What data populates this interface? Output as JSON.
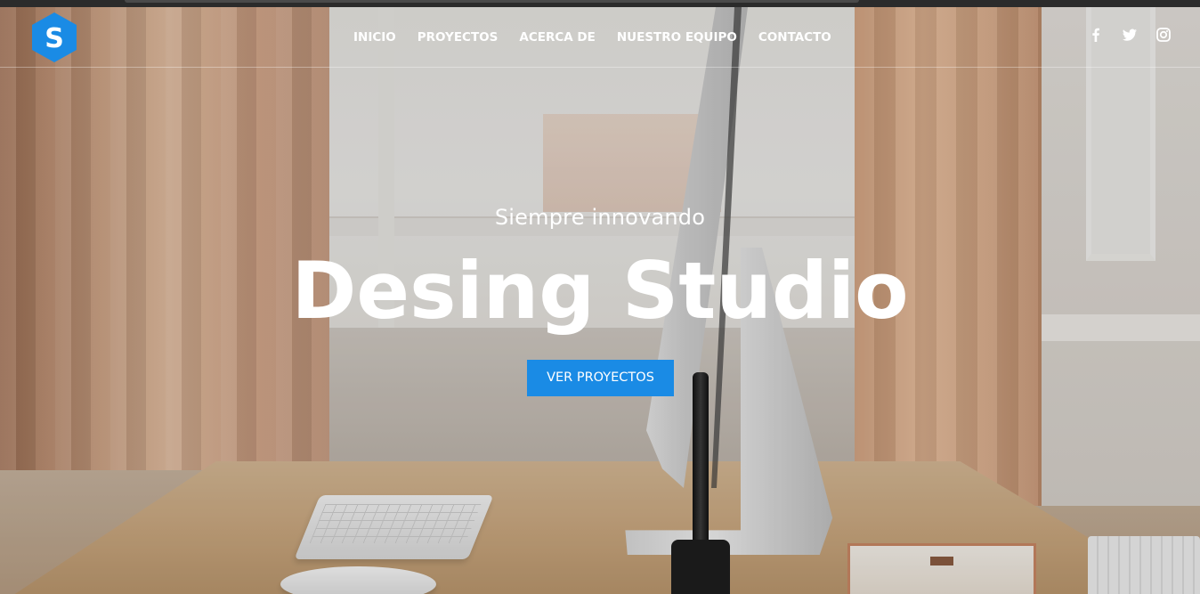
{
  "brand": {
    "logo_letter": "S",
    "logo_color": "#1a8be5"
  },
  "nav": {
    "items": [
      {
        "label": "INICIO"
      },
      {
        "label": "PROYECTOS"
      },
      {
        "label": "ACERCA DE"
      },
      {
        "label": "NUESTRO EQUIPO"
      },
      {
        "label": "CONTACTO"
      }
    ]
  },
  "social": {
    "icons": [
      "facebook-icon",
      "twitter-icon",
      "instagram-icon"
    ]
  },
  "hero": {
    "subtitle": "Siempre innovando",
    "title": "Desing Studio",
    "cta_label": "VER PROYECTOS",
    "cta_color": "#1a8be5"
  }
}
